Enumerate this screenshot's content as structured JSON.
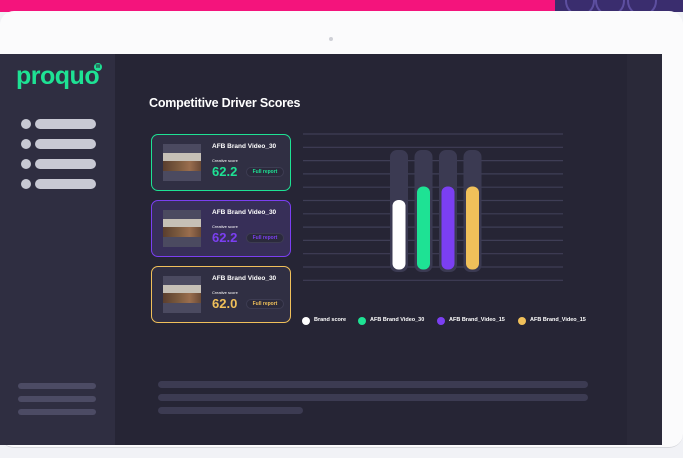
{
  "brand": {
    "logo": "proquo",
    "logo_mark": "W"
  },
  "page": {
    "title": "Competitive Driver Scores"
  },
  "cards": [
    {
      "title": "AFB Brand Video_30",
      "score_label": "Creative score",
      "score": "62.2",
      "report_label": "Full report",
      "accent": "#1ee294"
    },
    {
      "title": "AFB Brand Video_30",
      "score_label": "Creative score",
      "score": "62.2",
      "report_label": "Full report",
      "accent": "#7b3ff2"
    },
    {
      "title": "AFB Brand Video_30",
      "score_label": "Creative score",
      "score": "62.0",
      "report_label": "Full report",
      "accent": "#f0c05a"
    }
  ],
  "chart_data": {
    "type": "bar",
    "grid": true,
    "ylim": [
      0,
      100
    ],
    "series": [
      {
        "name": "Brand score",
        "value": 57,
        "color": "#ffffff"
      },
      {
        "name": "AFB Brand Video_30",
        "value": 68,
        "color": "#1ee294"
      },
      {
        "name": "AFB Brand_Video_15",
        "value": 68,
        "color": "#7b3ff2"
      },
      {
        "name": "AFB Brand_Video_15",
        "value": 68,
        "color": "#f0c05a"
      }
    ]
  },
  "colors": {
    "background": "#262535",
    "sidebar": "#2f2e41",
    "brand": "#1ee294",
    "banner": "#f4147c"
  }
}
